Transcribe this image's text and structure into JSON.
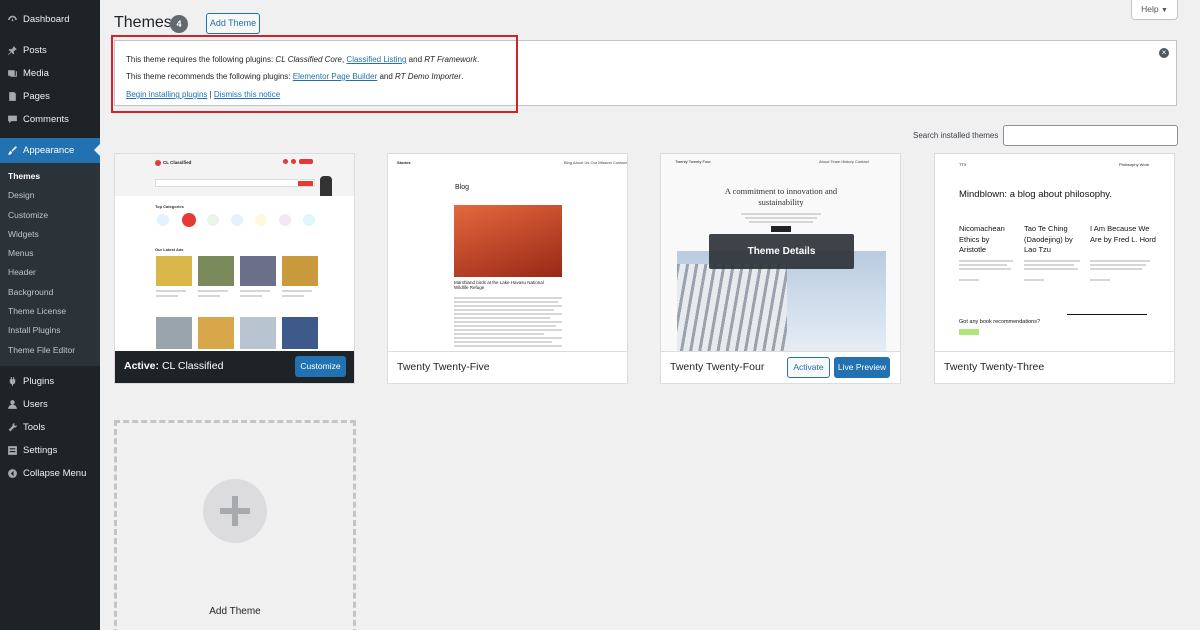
{
  "sidebar": {
    "items": [
      {
        "label": "Dashboard",
        "icon": "dashboard-icon"
      },
      {
        "label": "Posts",
        "icon": "pin-icon"
      },
      {
        "label": "Media",
        "icon": "media-icon"
      },
      {
        "label": "Pages",
        "icon": "pages-icon"
      },
      {
        "label": "Comments",
        "icon": "comment-icon"
      },
      {
        "label": "Appearance",
        "icon": "brush-icon"
      },
      {
        "label": "Plugins",
        "icon": "plugin-icon"
      },
      {
        "label": "Users",
        "icon": "users-icon"
      },
      {
        "label": "Tools",
        "icon": "wrench-icon"
      },
      {
        "label": "Settings",
        "icon": "settings-icon"
      },
      {
        "label": "Collapse Menu",
        "icon": "collapse-icon"
      }
    ],
    "submenu": [
      "Themes",
      "Design",
      "Customize",
      "Widgets",
      "Menus",
      "Header",
      "Background",
      "Theme License",
      "Install Plugins",
      "Theme File Editor"
    ]
  },
  "header": {
    "title": "Themes",
    "count": "4",
    "add_theme": "Add Theme",
    "help": "Help"
  },
  "notice": {
    "line1_prefix": "This theme requires the following plugins: ",
    "line1_p1": "CL Classified Core",
    "line1_sep1": ", ",
    "line1_p2": "Classified Listing",
    "line1_sep2": " and ",
    "line1_p3": "RT Framework",
    "line1_end": ".",
    "line2_prefix": "This theme recommends the following plugins: ",
    "line2_p1": "Elementor Page Builder",
    "line2_sep": " and ",
    "line2_p2": "RT Demo Importer",
    "line2_end": ".",
    "link_install": "Begin installing plugins",
    "divider": " | ",
    "link_dismiss": "Dismiss this notice"
  },
  "search": {
    "label": "Search installed themes"
  },
  "themes": {
    "active": {
      "prefix": "Active:",
      "name": "CL Classified",
      "button": "Customize"
    },
    "t25": {
      "name": "Twenty Twenty-Five"
    },
    "t24": {
      "name": "Twenty Twenty-Four",
      "overlay": "Theme Details",
      "activate": "Activate",
      "preview": "Live Preview"
    },
    "t23": {
      "name": "Twenty Twenty-Three"
    }
  },
  "previews": {
    "cl": {
      "logo": "CL Classified",
      "categories": "Top Categories",
      "ads": "Our Latest Ads"
    },
    "t25": {
      "site": "Stories",
      "nav": "Blog  About Us  Our Mission  Contact",
      "blog": "Blog",
      "caption": "Marshland birds at the Lake Havasu National Wildlife Refuge"
    },
    "t24": {
      "site": "Twenty Twenty Four",
      "nav": "About  Team  History  Contact",
      "headline": "A commitment to innovation and sustainability"
    },
    "t23": {
      "site": "TT3",
      "nav": "Philosophy  Work",
      "headline": "Mindblown: a blog about philosophy.",
      "post1": "Nicomachean Ethics by Aristotle",
      "post2": "Tao Te Ching (Daodejing) by Lao Tzu",
      "post3": "I Am Because We Are by Fred L. Hord",
      "cta": "Got any book recommendations?"
    }
  },
  "add_new": {
    "label": "Add Theme"
  },
  "colors": {
    "sidebar": "#1d2327",
    "accent": "#2271b1",
    "highlight": "#d0232b",
    "background": "#f0f0f1"
  }
}
